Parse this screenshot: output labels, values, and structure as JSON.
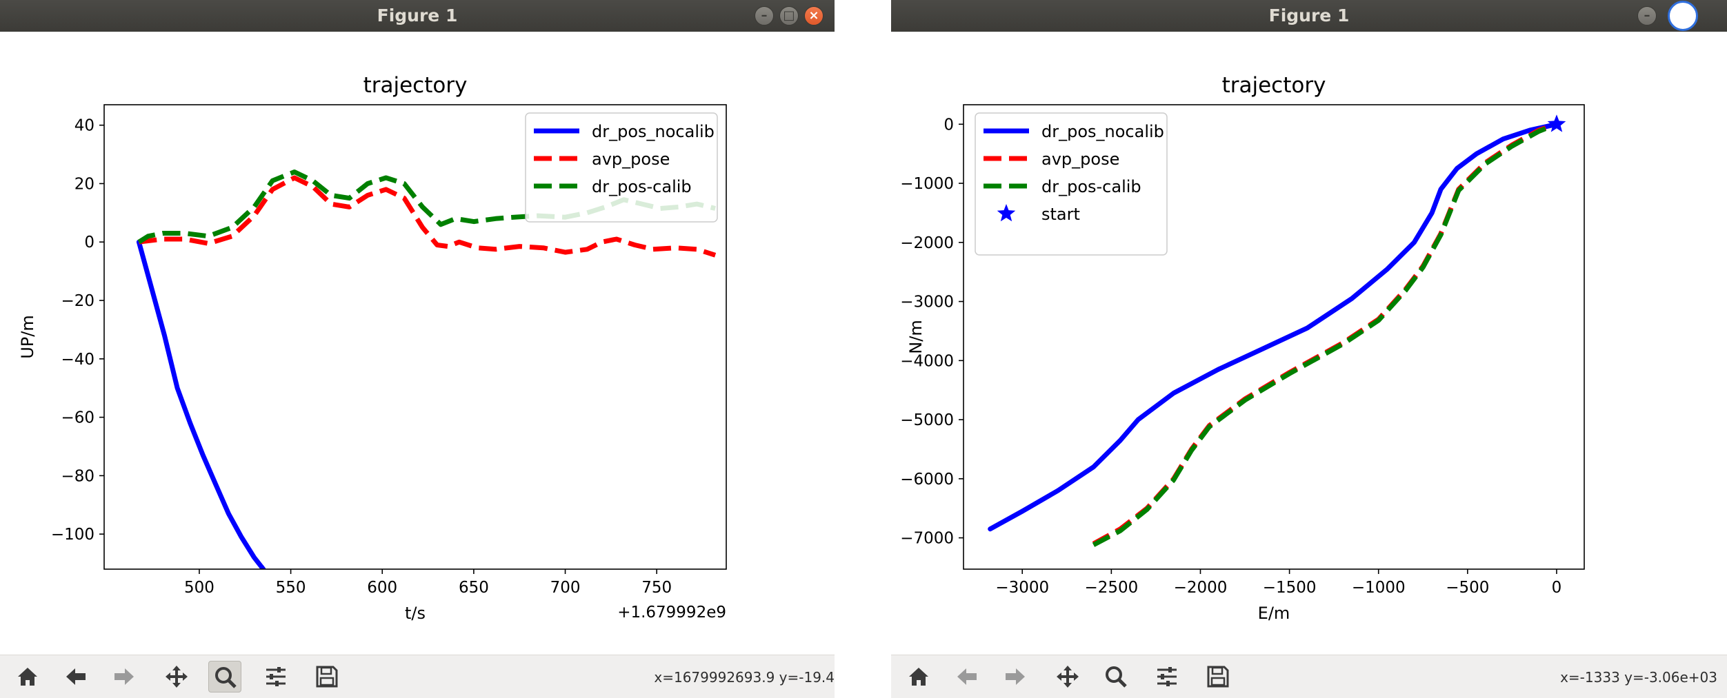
{
  "windows": [
    {
      "title": "Figure 1",
      "coords": "x=1679992693.9 y=-19.4",
      "active_tool": "zoom"
    },
    {
      "title": "Figure 1",
      "coords": "x=-1333 y=-3.06e+03",
      "active_tool": ""
    }
  ],
  "toolbar_icons": [
    "home-icon",
    "back-icon",
    "forward-icon",
    "pan-icon",
    "zoom-icon",
    "configure-subplots-icon",
    "save-icon"
  ],
  "colors": {
    "dr_pos_nocalib": "#0000ff",
    "avp_pose": "#ff0000",
    "dr_pos_calib": "#008000",
    "start": "#0000ff"
  },
  "chart_data": [
    {
      "type": "line",
      "title": "trajectory",
      "xlabel": "t/s",
      "ylabel": "UP/m",
      "offset_text": "+1.679992e9",
      "xlim": [
        448,
        788
      ],
      "ylim": [
        -112,
        47
      ],
      "xticks": [
        500,
        550,
        600,
        650,
        700,
        750
      ],
      "yticks": [
        40,
        20,
        0,
        -20,
        -40,
        -60,
        -80,
        -100
      ],
      "xtick_labels": [
        "500",
        "550",
        "600",
        "650",
        "700",
        "750"
      ],
      "ytick_labels": [
        "40",
        "20",
        "0",
        "−20",
        "−40",
        "−60",
        "−80",
        "−100"
      ],
      "legend_position": "top-right",
      "series": [
        {
          "name": "dr_pos_nocalib",
          "style": "solid",
          "color": "#0000ff",
          "x": [
            467,
            474,
            481,
            488,
            495,
            502,
            509,
            516,
            523,
            530,
            535
          ],
          "y": [
            0,
            -16,
            -32,
            -50,
            -62,
            -73,
            -83,
            -93,
            -101,
            -108,
            -112
          ]
        },
        {
          "name": "avp_pose",
          "style": "dashed",
          "color": "#ff0000",
          "x": [
            467,
            480,
            492,
            505,
            518,
            530,
            540,
            552,
            562,
            572,
            582,
            592,
            602,
            612,
            622,
            630,
            636,
            642,
            652,
            662,
            675,
            688,
            700,
            712,
            720,
            728,
            738,
            748,
            760,
            772,
            782
          ],
          "y": [
            0,
            1,
            1,
            -0.5,
            2,
            9,
            18,
            22,
            19,
            13,
            12,
            16,
            18,
            15,
            5,
            -1,
            -1.5,
            0,
            -2,
            -2.5,
            -1.5,
            -2,
            -3.5,
            -2.5,
            0,
            1,
            -1,
            -2.5,
            -2,
            -2.5,
            -4.5
          ]
        },
        {
          "name": "dr_pos-calib",
          "style": "dashed",
          "color": "#008000",
          "x": [
            467,
            472,
            480,
            492,
            505,
            518,
            530,
            540,
            552,
            562,
            572,
            582,
            592,
            602,
            612,
            622,
            632,
            640,
            650,
            662,
            672,
            685,
            700,
            712,
            722,
            732,
            742,
            752,
            762,
            772,
            782
          ],
          "y": [
            0,
            2,
            3,
            3,
            2,
            5,
            12,
            21,
            24,
            21,
            16,
            15,
            20,
            22,
            20,
            12,
            6,
            8,
            7,
            8,
            8.5,
            9,
            8.5,
            10,
            12,
            14.5,
            13,
            11.5,
            12,
            13,
            11.5
          ]
        }
      ]
    },
    {
      "type": "line",
      "title": "trajectory",
      "xlabel": "E/m",
      "ylabel": "N/m",
      "xlim": [
        -3330,
        155
      ],
      "ylim": [
        -7530,
        330
      ],
      "xticks": [
        -3000,
        -2500,
        -2000,
        -1500,
        -1000,
        -500,
        0
      ],
      "yticks": [
        0,
        -1000,
        -2000,
        -3000,
        -4000,
        -5000,
        -6000,
        -7000
      ],
      "xtick_labels": [
        "−3000",
        "−2500",
        "−2000",
        "−1500",
        "−1000",
        "−500",
        "0"
      ],
      "ytick_labels": [
        "0",
        "−1000",
        "−2000",
        "−3000",
        "−4000",
        "−5000",
        "−6000",
        "−7000"
      ],
      "legend_position": "top-left",
      "series": [
        {
          "name": "dr_pos_nocalib",
          "style": "solid",
          "color": "#0000ff",
          "x": [
            -3180,
            -3000,
            -2800,
            -2600,
            -2450,
            -2350,
            -2150,
            -1900,
            -1650,
            -1400,
            -1150,
            -950,
            -800,
            -700,
            -650,
            -560,
            -450,
            -300,
            -150,
            0
          ],
          "y": [
            -6850,
            -6550,
            -6200,
            -5800,
            -5350,
            -5000,
            -4550,
            -4150,
            -3800,
            -3450,
            -2950,
            -2450,
            -2000,
            -1500,
            -1100,
            -750,
            -500,
            -250,
            -100,
            0
          ]
        },
        {
          "name": "avp_pose",
          "style": "dashed",
          "color": "#ff0000",
          "x": [
            -2600,
            -2450,
            -2300,
            -2150,
            -2050,
            -1950,
            -1750,
            -1500,
            -1200,
            -1000,
            -850,
            -750,
            -650,
            -550,
            -400,
            -250,
            -100,
            0
          ],
          "y": [
            -7100,
            -6850,
            -6500,
            -6000,
            -5500,
            -5100,
            -4650,
            -4200,
            -3700,
            -3300,
            -2800,
            -2400,
            -1850,
            -1100,
            -650,
            -350,
            -100,
            0
          ]
        },
        {
          "name": "dr_pos-calib",
          "style": "dashed",
          "color": "#008000",
          "x": [
            -2600,
            -2450,
            -2300,
            -2150,
            -2050,
            -1950,
            -1750,
            -1500,
            -1200,
            -1000,
            -850,
            -750,
            -650,
            -550,
            -400,
            -250,
            -100,
            0
          ],
          "y": [
            -7120,
            -6880,
            -6520,
            -6020,
            -5520,
            -5120,
            -4670,
            -4220,
            -3720,
            -3320,
            -2820,
            -2420,
            -1870,
            -1120,
            -670,
            -370,
            -120,
            0
          ]
        },
        {
          "name": "start",
          "style": "marker-star",
          "color": "#0000ff",
          "x": [
            0
          ],
          "y": [
            0
          ]
        }
      ]
    }
  ]
}
